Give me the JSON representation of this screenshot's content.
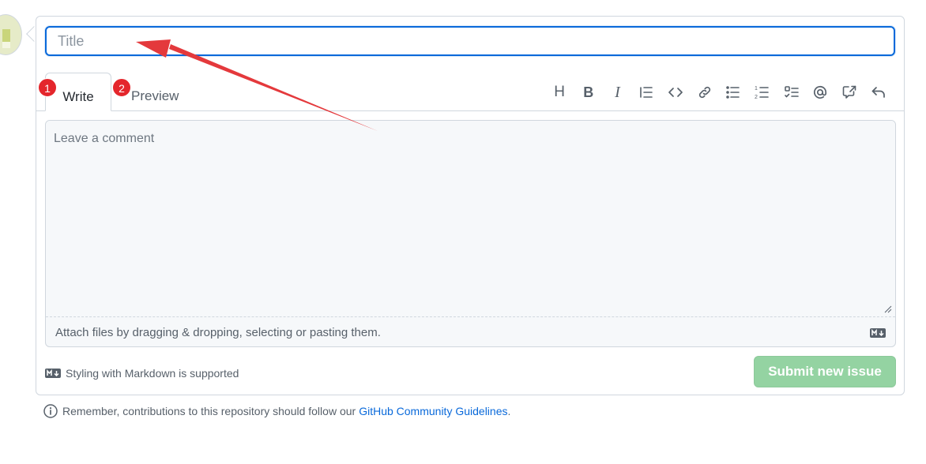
{
  "title_field": {
    "placeholder": "Title",
    "value": ""
  },
  "tabs": [
    {
      "label": "Write",
      "badge": "1",
      "active": true
    },
    {
      "label": "Preview",
      "badge": "2",
      "active": false
    }
  ],
  "toolbar": {
    "icons": [
      "heading-icon",
      "bold-icon",
      "italic-icon",
      "quote-icon",
      "code-icon",
      "link-icon",
      "bulleted-list-icon",
      "numbered-list-icon",
      "task-list-icon",
      "mention-icon",
      "cross-reference-icon",
      "reply-icon"
    ],
    "heading_glyph": "H",
    "bold_glyph": "B",
    "italic_glyph": "I"
  },
  "editor": {
    "placeholder": "Leave a comment",
    "attach_text": "Attach files by dragging & dropping, selecting or pasting them."
  },
  "footer": {
    "markdown_note": "Styling with Markdown is supported",
    "submit_label": "Submit new issue"
  },
  "notice": {
    "text": "Remember, contributions to this repository should follow our",
    "link_text": "GitHub Community Guidelines",
    "end": "."
  },
  "colors": {
    "accent": "#0969da",
    "submit_disabled": "#94d3a2",
    "badge": "#e4262c",
    "arrow": "#e4393c"
  }
}
